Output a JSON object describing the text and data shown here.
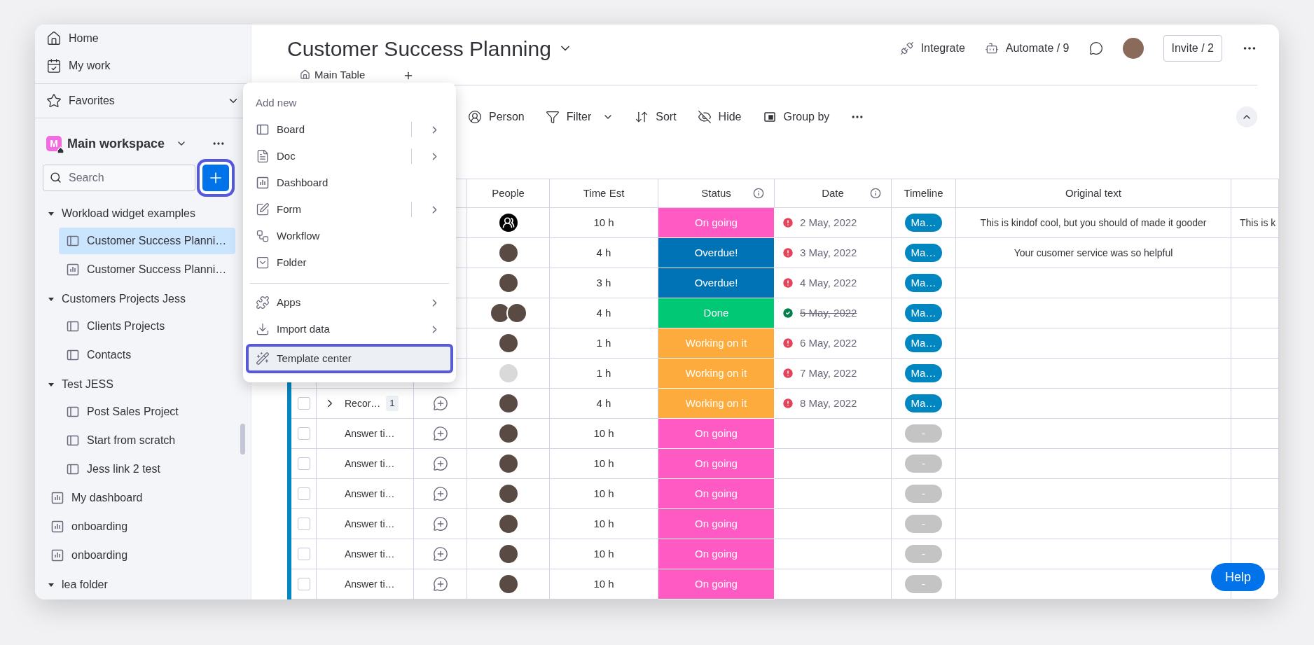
{
  "sidebar": {
    "nav": [
      {
        "label": "Home",
        "kind": "home"
      },
      {
        "label": "My work",
        "kind": "mywork"
      }
    ],
    "favorites": {
      "label": "Favorites",
      "expanded": false
    },
    "workspace": {
      "badge": "M",
      "name": "Main workspace"
    },
    "search": {
      "placeholder": "Search"
    },
    "tree": [
      {
        "label": "Workload widget examples",
        "kind": "folder",
        "expanded": true,
        "selected": false,
        "children": [
          {
            "label": "Customer Success Planni…",
            "kind": "board",
            "selected": true
          },
          {
            "label": "Customer Success Planni…",
            "kind": "dashboard",
            "selected": false
          }
        ]
      },
      {
        "label": "Customers Projects Jess",
        "kind": "folder",
        "expanded": true,
        "selected": false,
        "children": [
          {
            "label": "Clients Projects",
            "kind": "board",
            "selected": false
          },
          {
            "label": "Contacts",
            "kind": "board",
            "selected": false
          }
        ]
      },
      {
        "label": "Test JESS",
        "kind": "folder",
        "expanded": true,
        "selected": false,
        "children": [
          {
            "label": "Post Sales Project",
            "kind": "board",
            "selected": false
          },
          {
            "label": "Start from scratch",
            "kind": "board",
            "selected": false
          },
          {
            "label": "Jess link 2 test",
            "kind": "board",
            "selected": false
          }
        ]
      },
      {
        "label": "My dashboard",
        "kind": "dashboard",
        "selected": false
      },
      {
        "label": "onboarding",
        "kind": "dashboard",
        "selected": false
      },
      {
        "label": "onboarding",
        "kind": "dashboard",
        "selected": false
      },
      {
        "label": "lea folder",
        "kind": "folder",
        "expanded": true,
        "selected": false
      }
    ]
  },
  "board": {
    "title": "Customer Success Planning",
    "tabs": [
      {
        "label": "Main Table",
        "selected": true
      }
    ],
    "actions": [
      {
        "label": "Integrate",
        "kind": "integrate"
      },
      {
        "label": "Automate / 9",
        "kind": "automate"
      }
    ],
    "invite": "Invite / 2",
    "toolbar": [
      {
        "label": "Person",
        "kind": "person"
      },
      {
        "label": "Filter",
        "kind": "filter"
      },
      {
        "label": "Sort",
        "kind": "sort"
      },
      {
        "label": "Hide",
        "kind": "hide"
      },
      {
        "label": "Group by",
        "kind": "group"
      }
    ]
  },
  "menu": {
    "heading": "Add new",
    "sections": [
      [
        {
          "label": "Board",
          "kind": "board",
          "submenu": true,
          "split": true,
          "highlighted": false
        },
        {
          "label": "Doc",
          "kind": "doc",
          "submenu": true,
          "split": true,
          "highlighted": false
        },
        {
          "label": "Dashboard",
          "kind": "dashboard",
          "submenu": false,
          "split": false,
          "highlighted": false
        },
        {
          "label": "Form",
          "kind": "form",
          "submenu": true,
          "split": true,
          "highlighted": false
        },
        {
          "label": "Workflow",
          "kind": "workflow",
          "submenu": false,
          "split": false,
          "highlighted": false
        },
        {
          "label": "Folder",
          "kind": "folder",
          "submenu": false,
          "split": false,
          "highlighted": false
        }
      ],
      [
        {
          "label": "Apps",
          "kind": "apps",
          "submenu": true,
          "split": false,
          "highlighted": false
        },
        {
          "label": "Import data",
          "kind": "import",
          "submenu": true,
          "split": false,
          "highlighted": false
        },
        {
          "label": "Template center",
          "kind": "template",
          "submenu": false,
          "split": false,
          "highlighted": true
        }
      ]
    ]
  },
  "table": {
    "columns": [
      {
        "label": "People",
        "info": false
      },
      {
        "label": "Time Est",
        "info": false
      },
      {
        "label": "Status",
        "info": true
      },
      {
        "label": "Date",
        "info": true
      },
      {
        "label": "Timeline",
        "info": false
      },
      {
        "label": "Original text",
        "info": false
      }
    ],
    "rows": [
      {
        "people": [
          {
            "kind": "generic"
          }
        ],
        "time": "10 h",
        "status": {
          "text": "On going",
          "color": "#ff5ac4"
        },
        "date": {
          "text": "2 May, 2022",
          "kind": "overdue"
        },
        "timeline": {
          "text": "Ma…",
          "set": true
        },
        "original": "This is kindof cool, but you should of made it gooder",
        "column_10": "This is k"
      },
      {
        "people": [
          {
            "kind": "photo"
          }
        ],
        "time": "4 h",
        "status": {
          "text": "Overdue!",
          "color": "#0073b7"
        },
        "date": {
          "text": "3 May, 2022",
          "kind": "overdue"
        },
        "timeline": {
          "text": "Ma…",
          "set": true
        },
        "original": "Your cusomer service was so helpful"
      },
      {
        "people": [
          {
            "kind": "photo"
          }
        ],
        "time": "3 h",
        "status": {
          "text": "Overdue!",
          "color": "#0073b7"
        },
        "date": {
          "text": "4 May, 2022",
          "kind": "overdue"
        },
        "timeline": {
          "text": "Ma…",
          "set": true
        }
      },
      {
        "people": [
          {
            "kind": "photo"
          },
          {
            "kind": "photo"
          }
        ],
        "time": "4 h",
        "status": {
          "text": "Done",
          "color": "#00c875"
        },
        "date": {
          "text": "5 May, 2022",
          "kind": "done"
        },
        "timeline": {
          "text": "Ma…",
          "set": true
        }
      },
      {
        "people": [
          {
            "kind": "photo"
          }
        ],
        "time": "1 h",
        "status": {
          "text": "Working on it",
          "color": "#fdab3d"
        },
        "date": {
          "text": "6 May, 2022",
          "kind": "overdue"
        },
        "timeline": {
          "text": "Ma…",
          "set": true
        }
      },
      {
        "people": [
          {
            "kind": "faded"
          }
        ],
        "time": "1 h",
        "status": {
          "text": "Working on it",
          "color": "#fdab3d"
        },
        "date": {
          "text": "7 May, 2022",
          "kind": "overdue"
        },
        "timeline": {
          "text": "Ma…",
          "set": true
        }
      },
      {
        "checked": false,
        "name": "Recor…",
        "subitems": "1",
        "people": [
          {
            "kind": "photo"
          }
        ],
        "time": "4 h",
        "status": {
          "text": "Working on it",
          "color": "#fdab3d"
        },
        "date": {
          "text": "8 May, 2022",
          "kind": "overdue"
        },
        "timeline": {
          "text": "Ma…",
          "set": true
        }
      },
      {
        "checked": false,
        "name": "Answer ti…",
        "people": [
          {
            "kind": "photo"
          }
        ],
        "time": "10 h",
        "status": {
          "text": "On going",
          "color": "#ff5ac4"
        },
        "timeline": {
          "text": "-",
          "set": false
        }
      },
      {
        "checked": false,
        "name": "Answer ti…",
        "people": [
          {
            "kind": "photo"
          }
        ],
        "time": "10 h",
        "status": {
          "text": "On going",
          "color": "#ff5ac4"
        },
        "timeline": {
          "text": "-",
          "set": false
        }
      },
      {
        "checked": false,
        "name": "Answer ti…",
        "people": [
          {
            "kind": "photo"
          }
        ],
        "time": "10 h",
        "status": {
          "text": "On going",
          "color": "#ff5ac4"
        },
        "timeline": {
          "text": "-",
          "set": false
        }
      },
      {
        "checked": false,
        "name": "Answer ti…",
        "people": [
          {
            "kind": "photo"
          }
        ],
        "time": "10 h",
        "status": {
          "text": "On going",
          "color": "#ff5ac4"
        },
        "timeline": {
          "text": "-",
          "set": false
        }
      },
      {
        "checked": false,
        "name": "Answer ti…",
        "people": [
          {
            "kind": "photo"
          }
        ],
        "time": "10 h",
        "status": {
          "text": "On going",
          "color": "#ff5ac4"
        },
        "timeline": {
          "text": "-",
          "set": false
        }
      },
      {
        "checked": false,
        "name": "Answer ti…",
        "people": [
          {
            "kind": "photo"
          }
        ],
        "time": "10 h",
        "status": {
          "text": "On going",
          "color": "#ff5ac4"
        },
        "timeline": {
          "text": "-",
          "set": false
        }
      }
    ]
  },
  "help": "Help"
}
